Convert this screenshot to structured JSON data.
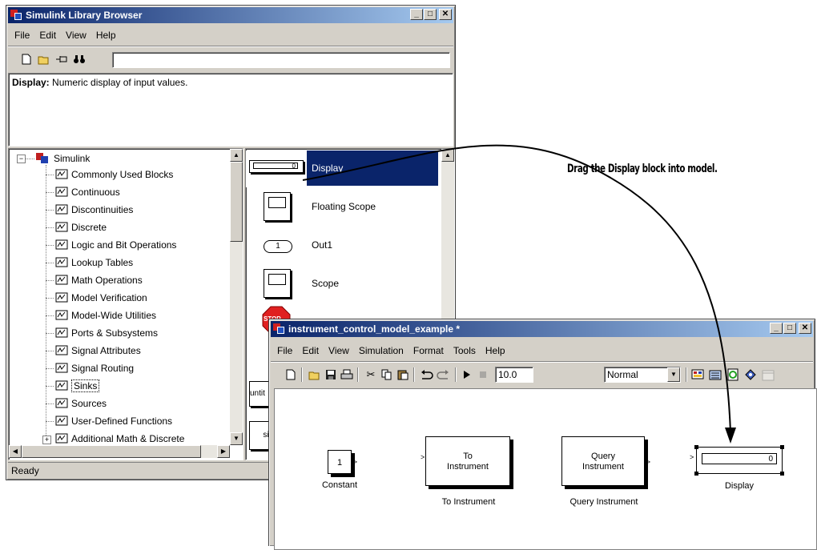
{
  "library_browser": {
    "title": "Simulink Library Browser",
    "menu": [
      "File",
      "Edit",
      "View",
      "Help"
    ],
    "search_value": "",
    "description_bold": "Display:",
    "description_text": " Numeric display of input values.",
    "status": "Ready",
    "tree_root": "Simulink",
    "tree_items": [
      "Commonly Used Blocks",
      "Continuous",
      "Discontinuities",
      "Discrete",
      "Logic and Bit Operations",
      "Lookup Tables",
      "Math Operations",
      "Model Verification",
      "Model-Wide Utilities",
      "Ports & Subsystems",
      "Signal Attributes",
      "Signal Routing",
      "Sinks",
      "Sources",
      "User-Defined Functions",
      "Additional Math & Discrete"
    ],
    "selected_tree_item": "Sinks",
    "blocks": [
      {
        "name": "Display",
        "glyph": "0"
      },
      {
        "name": "Floating Scope",
        "glyph": ""
      },
      {
        "name": "Out1",
        "glyph": "1"
      },
      {
        "name": "Scope",
        "glyph": ""
      }
    ],
    "partial_labels": {
      "untitled": "untit",
      "stop": "STOP",
      "sim": "si"
    }
  },
  "annotation": "Drag the Display block into model.",
  "model_window": {
    "title": "instrument_control_model_example *",
    "menu": [
      "File",
      "Edit",
      "View",
      "Simulation",
      "Format",
      "Tools",
      "Help"
    ],
    "stop_time": "10.0",
    "sim_mode": "Normal",
    "blocks": {
      "constant": {
        "value": "1",
        "label": "Constant"
      },
      "to_instrument": {
        "inner": [
          "To",
          "Instrument"
        ],
        "label": "To Instrument"
      },
      "query_instrument": {
        "inner": [
          "Query",
          "Instrument"
        ],
        "label": "Query Instrument"
      },
      "display": {
        "value": "0",
        "label": "Display"
      }
    }
  },
  "colors": {
    "selection": "#0a246a",
    "title_start": "#0a246a",
    "title_end": "#a6caf0",
    "chrome": "#d4d0c8"
  }
}
